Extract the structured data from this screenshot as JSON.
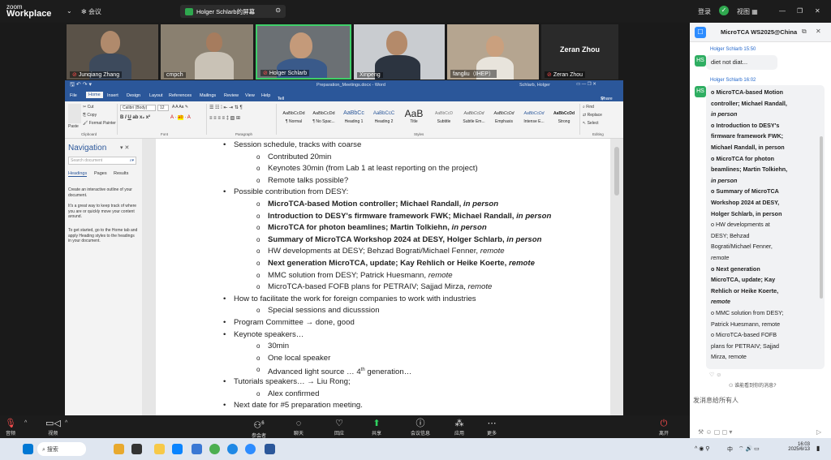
{
  "app": {
    "brand_top": "zoom",
    "brand_bottom": "Workplace"
  },
  "topbar": {
    "meeting_label": "会议",
    "share_label": "Holger Schlarb的屏幕",
    "register": "登录",
    "view": "视图"
  },
  "videos": [
    {
      "name": "Junqiang Zhang",
      "muted": true
    },
    {
      "name": "cmpch",
      "muted": false
    },
    {
      "name": "Holger Schlarb",
      "muted": true
    },
    {
      "name": "Xinpeng",
      "muted": false
    },
    {
      "name": "fangliu（IHEP）",
      "muted": false
    },
    {
      "name": "Zeran Zhou",
      "muted": true
    }
  ],
  "zeran_tile_big": "Zeran Zhou",
  "word": {
    "title": "Preparation_Meetings.docx - Word",
    "user": "Schlarb, Holger",
    "tabs": [
      "File",
      "Home",
      "Insert",
      "Design",
      "Layout",
      "References",
      "Mailings",
      "Review",
      "View",
      "Help"
    ],
    "tell_me": "Tell me what you want to do",
    "share": "Share",
    "clipboard": {
      "cut": "Cut",
      "copy": "Copy",
      "paste": "Paste",
      "format_painter": "Format Painter",
      "group": "Clipboard"
    },
    "font": {
      "name": "Calibri (Body)",
      "size": "12",
      "group": "Font"
    },
    "paragraph_group": "Paragraph",
    "styles_group": "Styles",
    "editing": {
      "find": "Find",
      "replace": "Replace",
      "select": "Select",
      "group": "Editing"
    },
    "styles": [
      {
        "sample": "AaBbCcDd",
        "name": "¶ Normal"
      },
      {
        "sample": "AaBbCcDd",
        "name": "¶ No Spac..."
      },
      {
        "sample": "AaBbCc",
        "name": "Heading 1"
      },
      {
        "sample": "AaBbCcC",
        "name": "Heading 2"
      },
      {
        "sample": "AaB",
        "name": "Title"
      },
      {
        "sample": "AaBbCcD",
        "name": "Subtitle"
      },
      {
        "sample": "AaBbCcDd",
        "name": "Subtle Em..."
      },
      {
        "sample": "AaBbCcDd",
        "name": "Emphasis"
      },
      {
        "sample": "AaBbCcDd",
        "name": "Intense E..."
      },
      {
        "sample": "AaBbCcDd",
        "name": "Strong"
      }
    ],
    "nav": {
      "title": "Navigation",
      "search_placeholder": "Search document",
      "tabs": [
        "Headings",
        "Pages",
        "Results"
      ],
      "help1": "Create an interactive outline of your document.",
      "help2": "It's a great way to keep track of where you are or quickly move your content around.",
      "help3": "To get started, go to the Home tab and apply Heading styles to the headings in your document."
    },
    "lines": [
      {
        "level": 1,
        "text": "Session schedule, tracks with coarse"
      },
      {
        "level": 2,
        "text": "Contributed 20min"
      },
      {
        "level": 2,
        "text": "Keynotes 30min (from Lab 1 at least reporting on the project)"
      },
      {
        "level": 2,
        "text": "Remote talks possible?"
      },
      {
        "level": 1,
        "text": "Possible contribution from DESY:"
      },
      {
        "level": 2,
        "bold": "MicroTCA-based Motion controller; Michael Randall,",
        "tail": " in person",
        "tail_style": "bi"
      },
      {
        "level": 2,
        "bold": "Introduction to DESY's firmware framework FWK; Michael Randall,",
        "tail": " in person",
        "tail_style": "bi"
      },
      {
        "level": 2,
        "bold": "MicroTCA for photon beamlines; Martin Tolkiehn,",
        "tail": " in person",
        "tail_style": "bi"
      },
      {
        "level": 2,
        "bold": "Summary of MicroTCA Workshop 2024 at DESY, Holger Schlarb,",
        "tail": " in person",
        "tail_style": "bi"
      },
      {
        "level": 2,
        "text": "HW developments at DESY; Behzad Bograti/Michael Fenner,",
        "tail": " remote",
        "tail_style": "i"
      },
      {
        "level": 2,
        "bold": "Next generation MicroTCA, update; Kay Rehlich or Heike Koerte,",
        "tail": " remote",
        "tail_style": "bi"
      },
      {
        "level": 2,
        "text": "MMC solution from DESY; Patrick Huesmann,",
        "tail": " remote",
        "tail_style": "i"
      },
      {
        "level": 2,
        "text": "MicroTCA-based FOFB plans for PETRAIV; Sajjad Mirza,",
        "tail": " remote",
        "tail_style": "i"
      },
      {
        "level": 1,
        "text": "How to facilitate the work for foreign companies to work with industries"
      },
      {
        "level": 2,
        "text": "Special sessions and dicusssion"
      },
      {
        "level": 1,
        "text": "Program Committee → done, good"
      },
      {
        "level": 1,
        "text": "Keynote speakers…"
      },
      {
        "level": 2,
        "text": "30min"
      },
      {
        "level": 2,
        "text": "One local speaker"
      },
      {
        "level": 2,
        "text": "Advanced light source … 4",
        "sup": "th",
        "tail": " generation…",
        "tail_style": "n"
      },
      {
        "level": 1,
        "text": "Tutorials speakers… → Liu Rong;"
      },
      {
        "level": 2,
        "text": "Alex confirmed"
      },
      {
        "level": 1,
        "text": "Next date for #5 preparation meeting."
      }
    ]
  },
  "chat": {
    "title": "MicroTCA WS2025@China",
    "sender1": "Holger Schlarb 15:50",
    "msg1": "diet not diat...",
    "sender2": "Holger Schlarb 16:02",
    "avatar": "HS",
    "msg2_lines": [
      {
        "t": "o  MicroTCA-based Motion",
        "s": "b"
      },
      {
        "t": "controller; Michael Randall,",
        "s": "b"
      },
      {
        "t": "in person",
        "s": "bi"
      },
      {
        "t": "o  Introduction to DESY's",
        "s": "b"
      },
      {
        "t": "firmware framework FWK;",
        "s": "b"
      },
      {
        "t": "Michael Randall, in person",
        "s": "b"
      },
      {
        "t": "o  MicroTCA for photon",
        "s": "b"
      },
      {
        "t": "beamlines; Martin Tolkiehn,",
        "s": "b"
      },
      {
        "t": "in person",
        "s": "bi"
      },
      {
        "t": "o  Summary of MicroTCA",
        "s": "b"
      },
      {
        "t": "Workshop 2024 at DESY,",
        "s": "b"
      },
      {
        "t": "Holger Schlarb, in person",
        "s": "b"
      },
      {
        "t": "o  HW developments at",
        "s": "n"
      },
      {
        "t": "DESY; Behzad",
        "s": "n"
      },
      {
        "t": "Bograti/Michael Fenner,",
        "s": "n"
      },
      {
        "t": "remote",
        "s": "i"
      },
      {
        "t": "o  Next generation",
        "s": "b"
      },
      {
        "t": "MicroTCA, update; Kay",
        "s": "b"
      },
      {
        "t": "Rehlich or Heike Koerte,",
        "s": "b"
      },
      {
        "t": "remote",
        "s": "bi"
      },
      {
        "t": "o  MMC solution from DESY;",
        "s": "n"
      },
      {
        "t": "Patrick Huesmann, remote",
        "s": "n"
      },
      {
        "t": "o  MicroTCA-based FOFB",
        "s": "n"
      },
      {
        "t": "plans for PETRAIV; Sajjad",
        "s": "n"
      },
      {
        "t": "Mirza, remote",
        "s": "n"
      }
    ],
    "reply_hint": "谁能看到你的消息?",
    "input_placeholder": "发消息给所有人"
  },
  "toolbar": {
    "audio": "音频",
    "video": "视频",
    "participants": "参会者",
    "participants_count": "6",
    "chat": "聊天",
    "react": "回应",
    "share": "共享",
    "info": "会议信息",
    "apps": "应用",
    "more": "更多",
    "leave": "离开"
  },
  "taskbar": {
    "search": "搜索",
    "ime": "中",
    "time": "16:03",
    "date": "2025/6/13"
  },
  "colors": {
    "word_blue": "#2b579a",
    "zoom_green": "#2fa84f",
    "chat_avatar": "#2fae62",
    "link_blue": "#2468cc"
  }
}
